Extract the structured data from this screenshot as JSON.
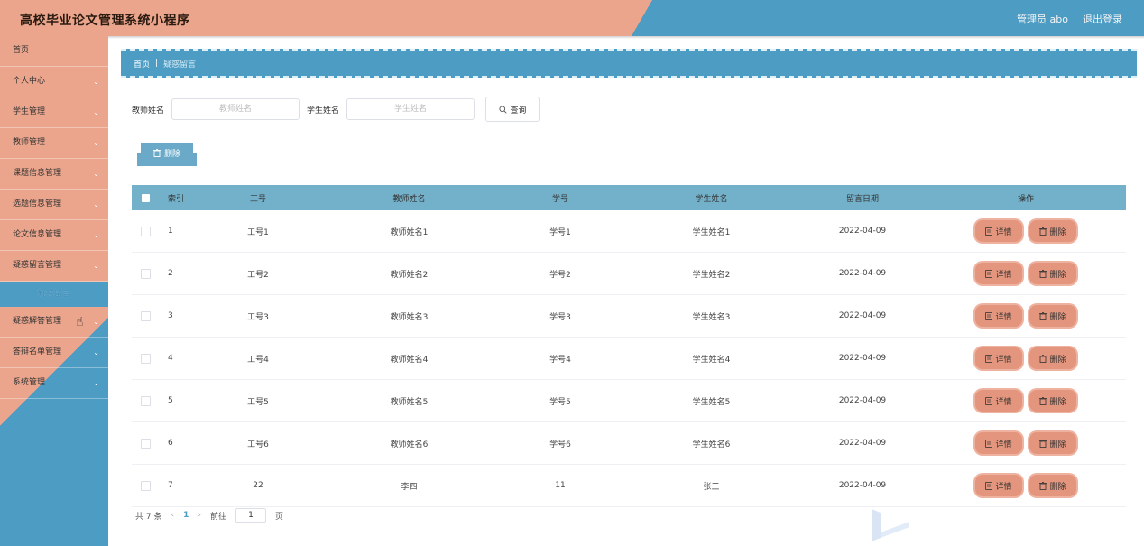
{
  "header": {
    "app_title": "高校毕业论文管理系统小程序",
    "user_label": "管理员 abo",
    "logout_label": "退出登录"
  },
  "sidebar": {
    "items": [
      {
        "label": "首页",
        "has_chevron": false
      },
      {
        "label": "个人中心",
        "has_chevron": true
      },
      {
        "label": "学生管理",
        "has_chevron": true
      },
      {
        "label": "教师管理",
        "has_chevron": true
      },
      {
        "label": "课题信息管理",
        "has_chevron": true
      },
      {
        "label": "选题信息管理",
        "has_chevron": true
      },
      {
        "label": "论文信息管理",
        "has_chevron": true
      },
      {
        "label": "疑惑留言管理",
        "has_chevron": true
      }
    ],
    "active_sub_item": "疑惑留言",
    "items_after": [
      {
        "label": "疑惑解答管理",
        "has_chevron": true
      },
      {
        "label": "答辩名单管理",
        "has_chevron": true
      },
      {
        "label": "系统管理",
        "has_chevron": true
      }
    ]
  },
  "breadcrumb": {
    "home": "首页",
    "separator": "|",
    "current": "疑惑留言"
  },
  "search": {
    "teacher_label": "教师姓名",
    "teacher_placeholder": "教师姓名",
    "student_label": "学生姓名",
    "student_placeholder": "学生姓名",
    "query_label": "查询"
  },
  "batch_delete_label": "删除",
  "table": {
    "headers": [
      "索引",
      "工号",
      "教师姓名",
      "学号",
      "学生姓名",
      "留言日期",
      "操作"
    ],
    "detail_label": "详情",
    "delete_label": "删除",
    "rows": [
      {
        "idx": "1",
        "gh": "工号1",
        "tn": "教师姓名1",
        "xh": "学号1",
        "sn": "学生姓名1",
        "date": "2022-04-09"
      },
      {
        "idx": "2",
        "gh": "工号2",
        "tn": "教师姓名2",
        "xh": "学号2",
        "sn": "学生姓名2",
        "date": "2022-04-09"
      },
      {
        "idx": "3",
        "gh": "工号3",
        "tn": "教师姓名3",
        "xh": "学号3",
        "sn": "学生姓名3",
        "date": "2022-04-09"
      },
      {
        "idx": "4",
        "gh": "工号4",
        "tn": "教师姓名4",
        "xh": "学号4",
        "sn": "学生姓名4",
        "date": "2022-04-09"
      },
      {
        "idx": "5",
        "gh": "工号5",
        "tn": "教师姓名5",
        "xh": "学号5",
        "sn": "学生姓名5",
        "date": "2022-04-09"
      },
      {
        "idx": "6",
        "gh": "工号6",
        "tn": "教师姓名6",
        "xh": "学号6",
        "sn": "学生姓名6",
        "date": "2022-04-09"
      },
      {
        "idx": "7",
        "gh": "22",
        "tn": "李四",
        "xh": "11",
        "sn": "张三",
        "date": "2022-04-09"
      }
    ]
  },
  "pagination": {
    "total": "共 7 条",
    "prev": "‹",
    "current_page": "1",
    "next": "›",
    "goto_label": "前往",
    "goto_value": "1",
    "page_unit": "页"
  },
  "colors": {
    "salmon": "#eba58c",
    "blue": "#4d9cc4",
    "table_header": "#73b0ca",
    "op_button": "#e3957d"
  }
}
